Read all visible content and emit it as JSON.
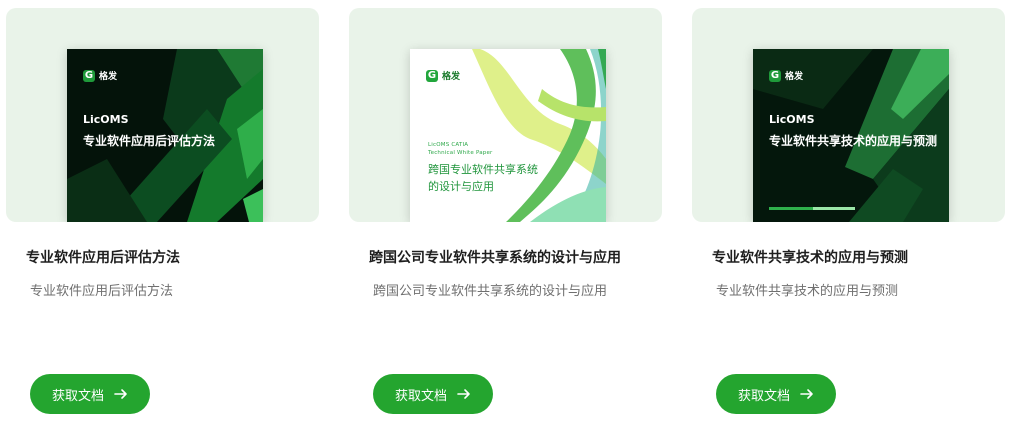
{
  "cards": [
    {
      "cover": {
        "logo_glyph": "G",
        "logo_text": "格发",
        "brand": "LicOMS",
        "title": "专业软件应用后评估方法"
      },
      "title": "专业软件应用后评估方法",
      "description": "专业软件应用后评估方法",
      "button_label": "获取文档",
      "button_icon": "arrow-right-icon"
    },
    {
      "cover": {
        "logo_glyph": "G",
        "logo_text": "格发",
        "brand": "LicOMS CATIA",
        "subtitle": "Technical White Paper",
        "title": "跨国专业软件共享系统的设计与应用"
      },
      "title": "跨国公司专业软件共享系统的设计与应用",
      "description": "跨国公司专业软件共享系统的设计与应用",
      "button_label": "获取文档",
      "button_icon": "arrow-right-icon"
    },
    {
      "cover": {
        "logo_glyph": "G",
        "logo_text": "格发",
        "brand": "LicOMS",
        "title": "专业软件共享技术的应用与预测"
      },
      "title": "专业软件共享技术的应用与预测",
      "description": "专业软件共享技术的应用与预测",
      "button_label": "获取文档",
      "button_icon": "arrow-right-icon"
    }
  ],
  "colors": {
    "accent": "#24a52f",
    "thumb_background": "#e9f3e9",
    "title_text": "#1e1e1e",
    "description_text": "#6f6f6f"
  }
}
